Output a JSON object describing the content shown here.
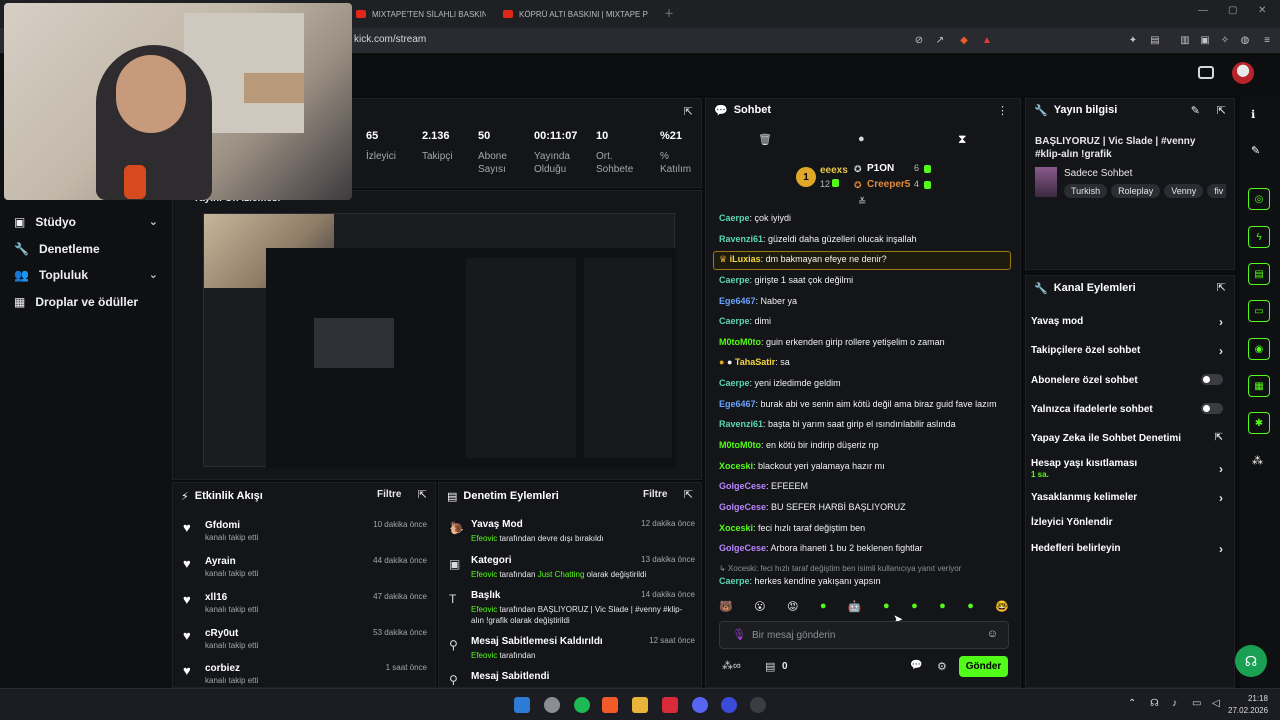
{
  "browser": {
    "tabs": [
      "MIXTAPE'TEN SİLAHLI BASKIN! | KÖPR",
      "KÖPRÜ ALTI BASKINI | MIXTAPE POV"
    ],
    "url": "kick.com/stream"
  },
  "sidebar": {
    "items": [
      {
        "label": "Stüdyo",
        "icon": "video-icon",
        "chevron": true
      },
      {
        "label": "Denetleme",
        "icon": "wrench-icon",
        "chevron": false
      },
      {
        "label": "Topluluk",
        "icon": "people-icon",
        "chevron": true
      },
      {
        "label": "Droplar ve ödüller",
        "icon": "gift-icon",
        "chevron": false
      }
    ]
  },
  "stats": [
    {
      "value": "65",
      "label": "İzleyici"
    },
    {
      "value": "2.136",
      "label": "Takipçi"
    },
    {
      "value": "50",
      "label": "Abone Sayısı"
    },
    {
      "value": "00:11:07",
      "label": "Yayında Olduğu"
    },
    {
      "value": "10",
      "label": "Ort. Sohbete"
    },
    {
      "value": "%21",
      "label": "% Katılım"
    }
  ],
  "preview": {
    "title": "Yayını Ön İzlemesi"
  },
  "activity": {
    "title": "Etkinlik Akışı",
    "filter": "Filtre",
    "items": [
      {
        "name": "Gfdomi",
        "sub": "kanalı takip etti",
        "time": "10 dakika önce"
      },
      {
        "name": "Ayrain",
        "sub": "kanalı takip etti",
        "time": "44 dakika önce"
      },
      {
        "name": "xll16",
        "sub": "kanalı takip etti",
        "time": "47 dakika önce"
      },
      {
        "name": "cRy0ut",
        "sub": "kanalı takip etti",
        "time": "53 dakika önce"
      },
      {
        "name": "corbiez",
        "sub": "kanalı takip etti",
        "time": "1 saat önce"
      }
    ]
  },
  "modactions": {
    "title": "Denetim Eylemleri",
    "filter": "Filtre",
    "items": [
      {
        "name": "Yavaş Mod",
        "sub1": "Efeovic",
        "sub2": " tarafından devre dışı bırakıldı",
        "sub3": "",
        "sub4": "",
        "time": "12 dakika önce"
      },
      {
        "name": "Kategori",
        "sub1": "Efeovic",
        "sub2": " tarafından ",
        "sub3": "Just Chatting",
        "sub4": " olarak değiştirildi",
        "time": "13 dakika önce"
      },
      {
        "name": "Başlık",
        "sub1": "Efeovic",
        "sub2": " tarafından BAŞLIYORUZ | Vic Slade | #venny #klip-alın !grafik",
        "sub3": "",
        "sub4": " olarak değiştirildi",
        "time": "14 dakika önce"
      },
      {
        "name": "Mesaj Sabitlemesi Kaldırıldı",
        "sub1": "Efeovic",
        "sub2": " tarafından",
        "sub3": "",
        "sub4": "",
        "time": "12 saat önce"
      },
      {
        "name": "Mesaj Sabitlendi",
        "sub1": "",
        "sub2": "",
        "sub3": "",
        "sub4": "",
        "time": ""
      }
    ]
  },
  "chat": {
    "title": "Sohbet",
    "leaders": [
      {
        "rank": "1",
        "name": "eeexs",
        "count": "12"
      },
      {
        "rank": "",
        "name": "P1ON",
        "count": "6"
      },
      {
        "rank": "",
        "name": "Creeper5",
        "count": "4"
      }
    ],
    "messages": [
      {
        "user": "Caerpe",
        "color": "#5cd6b5",
        "text": "çok iyiydi"
      },
      {
        "user": "Ravenzi61",
        "color": "#5cd6b5",
        "text": "güzeldi daha güzelleri olucak inşallah"
      },
      {
        "user": "iLuxias",
        "color": "#f5d742",
        "text": "dm bakmayan efeye ne denir?"
      },
      {
        "user": "Caerpe",
        "color": "#5cd6b5",
        "text": "girişte 1 saat çok değilmi"
      },
      {
        "user": "Ege6467",
        "color": "#6aa4ff",
        "text": "Naber ya"
      },
      {
        "user": "Caerpe",
        "color": "#5cd6b5",
        "text": "dimi"
      },
      {
        "user": "M0toM0to",
        "color": "#53fc18",
        "text": "guin erkenden girip rollere yetişelim o zaman"
      },
      {
        "user": "TahaSatir",
        "color": "#f5d742",
        "text": "sa"
      },
      {
        "user": "Caerpe",
        "color": "#5cd6b5",
        "text": "yeni izledimde geldim"
      },
      {
        "user": "Ege6467",
        "color": "#6aa4ff",
        "text": "burak abi ve senin aim kötü değil ama biraz guid fave lazım"
      },
      {
        "user": "Ravenzi61",
        "color": "#5cd6b5",
        "text": "başta bi yarım saat girip el ısındırılabilir aslında"
      },
      {
        "user": "M0toM0to",
        "color": "#53fc18",
        "text": "en kötü bir indirip düşeriz np"
      },
      {
        "user": "Xoceski",
        "color": "#53fc18",
        "text": "blackout yeri yalamaya hazır mı"
      },
      {
        "user": "GolgeCese",
        "color": "#b886ff",
        "text": "EFEEEM"
      },
      {
        "user": "GolgeCese",
        "color": "#b886ff",
        "text": "BU SEFER HARBİ BAŞLIYORUZ"
      },
      {
        "user": "Xoceski",
        "color": "#53fc18",
        "text": "feci hızlı taraf değiştim ben"
      },
      {
        "user": "GolgeCese",
        "color": "#b886ff",
        "text": "Arbora ihaneti 1 bu 2 beklenen fightlar"
      }
    ],
    "reply": "↳ Xoceski: feci hızlı taraf değiştim ben isimli kullanıcıya yanıt veriyor",
    "last": {
      "user": "Caerpe",
      "color": "#5cd6b5",
      "text": "herkes kendine yakışanı yapsın"
    },
    "input_placeholder": "Bir mesaj gönderin",
    "points": "0",
    "send": "Gönder"
  },
  "streaminfo": {
    "title": "Yayın bilgisi",
    "stream_title": "BAŞLIYORUZ | Vic Slade | #venny #klip-alın !grafik",
    "category": "Sadece Sohbet",
    "tags": [
      "Turkish",
      "Roleplay",
      "Venny",
      "fiv"
    ]
  },
  "channelactions": {
    "title": "Kanal Eylemleri",
    "items": [
      {
        "label": "Yavaş mod",
        "kind": "chevron",
        "sub": ""
      },
      {
        "label": "Takipçilere özel sohbet",
        "kind": "chevron",
        "sub": ""
      },
      {
        "label": "Abonelere özel sohbet",
        "kind": "toggle",
        "sub": ""
      },
      {
        "label": "Yalnızca ifadelerle sohbet",
        "kind": "toggle",
        "sub": ""
      },
      {
        "label": "Yapay Zeka ile Sohbet Denetimi",
        "kind": "external",
        "sub": ""
      },
      {
        "label": "Hesap yaşı kısıtlaması",
        "kind": "chevron",
        "sub": "1 sa."
      },
      {
        "label": "Yasaklanmış kelimeler",
        "kind": "chevron",
        "sub": ""
      },
      {
        "label": "İzleyici Yönlendir",
        "kind": "none",
        "sub": ""
      },
      {
        "label": "Hedefleri belirleyin",
        "kind": "chevron",
        "sub": ""
      }
    ]
  },
  "taskbar": {
    "time": "21:18",
    "date": "27.02.2026"
  },
  "colors": {
    "accent": "#53fc18",
    "panel": "#141518",
    "bg": "#0b0c0e"
  }
}
